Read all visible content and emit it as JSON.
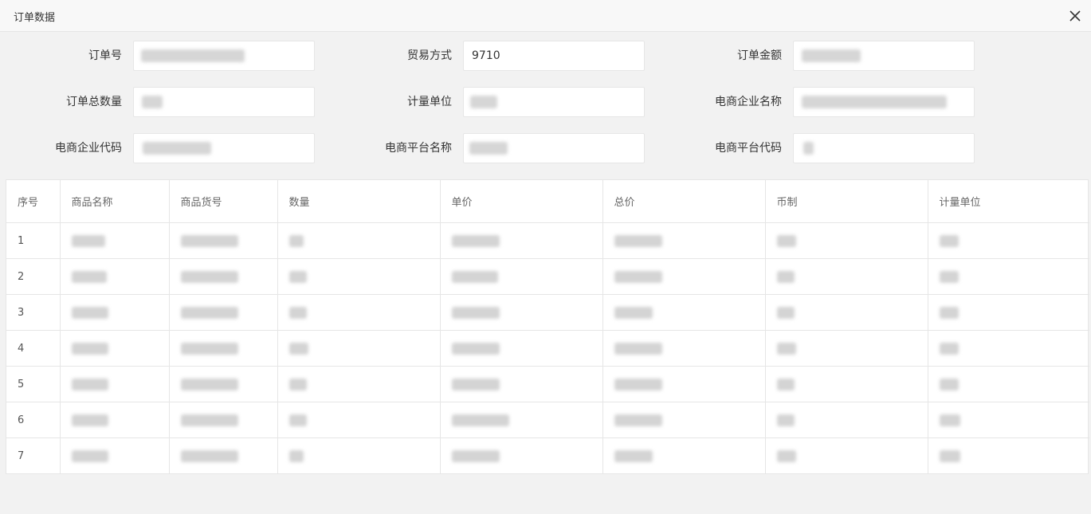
{
  "dialog": {
    "title": "订单数据"
  },
  "form": {
    "order_no_label": "订单号",
    "trade_mode_label": "贸易方式",
    "trade_mode_value": "9710",
    "order_amount_label": "订单金额",
    "order_total_qty_label": "订单总数量",
    "unit_label": "计量单位",
    "ecommerce_company_name_label": "电商企业名称",
    "ecommerce_company_code_label": "电商企业代码",
    "ecommerce_platform_name_label": "电商平台名称",
    "ecommerce_platform_code_label": "电商平台代码"
  },
  "table": {
    "headers": [
      "序号",
      "商品名称",
      "商品货号",
      "数量",
      "单价",
      "总价",
      "币制",
      "计量单位"
    ],
    "row_numbers": [
      "1",
      "2",
      "3",
      "4",
      "5",
      "6",
      "7"
    ]
  },
  "icons": {
    "close": "close-icon"
  }
}
